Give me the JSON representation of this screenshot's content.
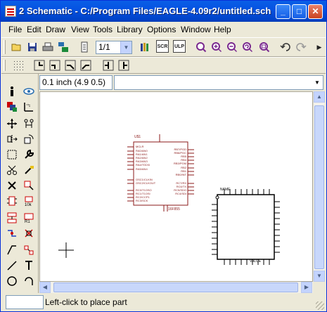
{
  "window": {
    "title": "2 Schematic - C:/Program Files/EAGLE-4.09r2/untitled.sch",
    "minimize": "_",
    "maximize": "□",
    "close": "✕"
  },
  "menu": [
    "File",
    "Edit",
    "Draw",
    "View",
    "Tools",
    "Library",
    "Options",
    "Window",
    "Help"
  ],
  "toolbar": {
    "sheet_select": "1/1",
    "ulp_label": "ULP",
    "scr_label": "SCR"
  },
  "coord_display": "0.1 inch (4.9 0.5)",
  "command_input": "",
  "status": {
    "message": "Left-click to place part",
    "indicator": ""
  },
  "schematic": {
    "part1": {
      "name": "U$1",
      "value": "16F855",
      "pins_left": [
        "MCLR",
        "RA0/AN0",
        "RA1/AN1",
        "RA2/AN2",
        "RA3/AN3",
        "RA4/T0CKI",
        "RA5/AN4",
        "OSC1/CLKIN",
        "OSC2/CLKOUT",
        "RC0/T1OSO",
        "RC1/T1OSI",
        "RC2/CCP1",
        "RC3/SCK"
      ],
      "pins_right": [
        "RB7/PGD",
        "RB6/PGC",
        "RB5",
        "RB4",
        "RB3/PGM",
        "RB2",
        "RB1",
        "RB0/INT",
        "RC7/RX",
        "RC6/TX",
        "RC5/SDO",
        "RC4/SDI"
      ]
    },
    "part2": {
      "name": "NAME",
      "value": "VALUE"
    }
  },
  "colors": {
    "accent": "#0553e2",
    "part_outline": "#8b1a1a",
    "pin_color": "#8b1a1a"
  }
}
